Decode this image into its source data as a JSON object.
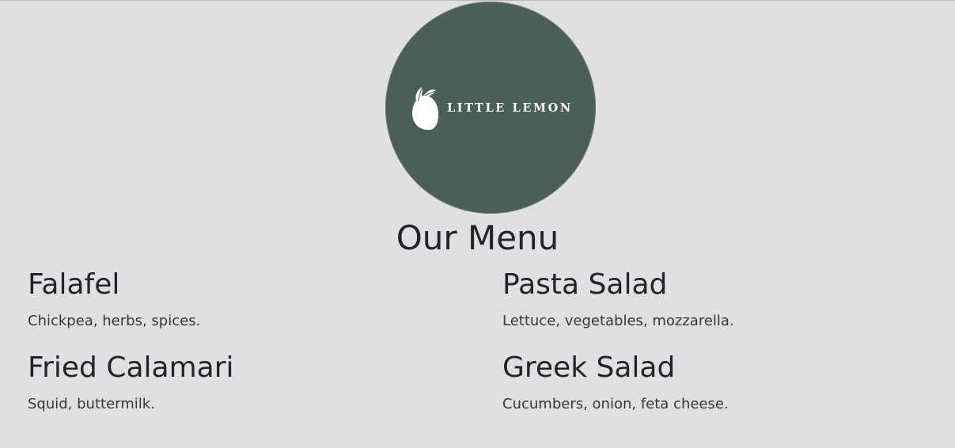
{
  "brand": {
    "name": "LITTLE LEMON",
    "logo_color": "#4a5f56",
    "icon": "lemon-icon"
  },
  "menu": {
    "title": "Our Menu",
    "items": [
      {
        "name": "Falafel",
        "description": "Chickpea, herbs, spices."
      },
      {
        "name": "Pasta Salad",
        "description": "Lettuce, vegetables, mozzarella."
      },
      {
        "name": "Fried Calamari",
        "description": "Squid, buttermilk."
      },
      {
        "name": "Greek Salad",
        "description": "Cucumbers, onion, feta cheese."
      }
    ]
  }
}
